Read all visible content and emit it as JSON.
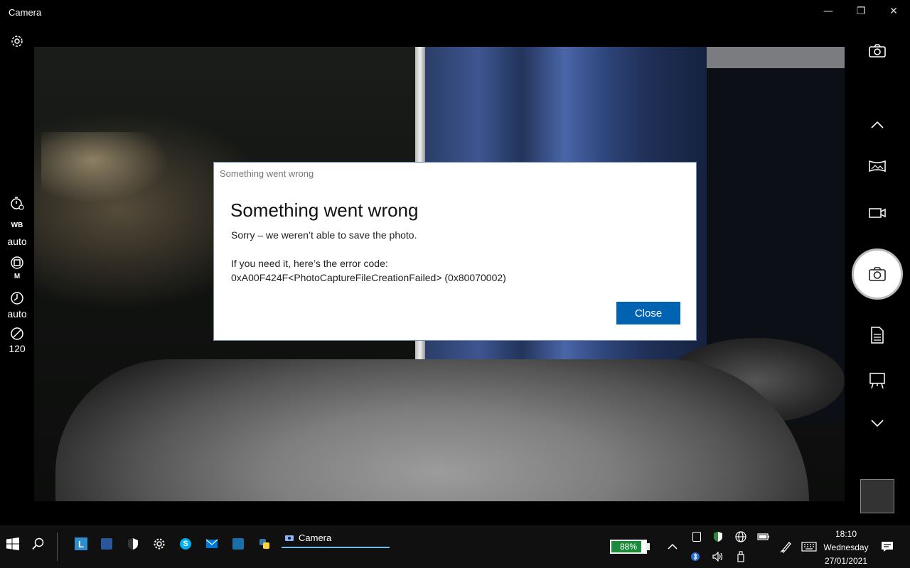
{
  "window": {
    "title": "Camera",
    "controls": {
      "minimize": "—",
      "restore": "❐",
      "close": "✕"
    }
  },
  "left_rail": {
    "wb_label": "WB",
    "wb_value": "auto",
    "focus_value": "M",
    "exposure_value": "auto",
    "iso_value": "120"
  },
  "dialog": {
    "caption": "Something went wrong",
    "title": "Something went wrong",
    "message": "Sorry – we weren’t able to save the photo.",
    "code_label": "If you need it, here’s the error code:",
    "code": "0xA00F424F<PhotoCaptureFileCreationFailed> (0x80070002)",
    "close_label": "Close"
  },
  "taskbar": {
    "active_app": "Camera",
    "battery_percent": "88%",
    "battery_level": 0.88,
    "time": "18:10",
    "day": "Wednesday",
    "date": "27/01/2021",
    "accent_color": "#0063b1"
  }
}
